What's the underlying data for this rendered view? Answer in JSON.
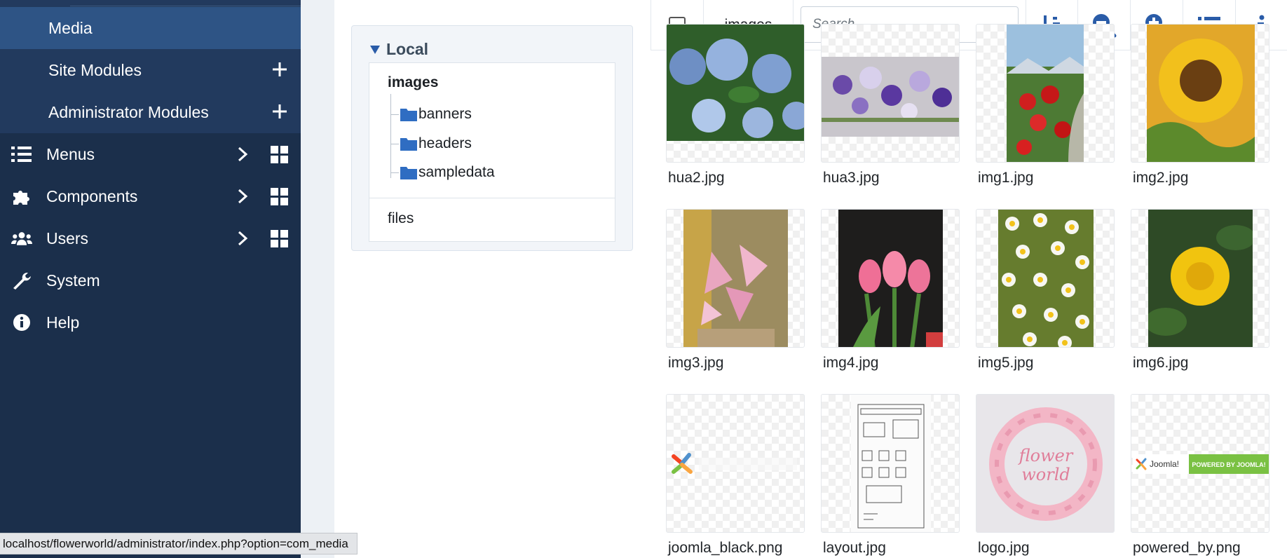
{
  "sidebar": {
    "sub_items": [
      {
        "label": "Media",
        "active": true
      },
      {
        "label": "Site Modules"
      },
      {
        "label": "Administrator Modules"
      }
    ],
    "main_items": [
      {
        "label": "Menus",
        "icon": "list-icon"
      },
      {
        "label": "Components",
        "icon": "puzzle-icon"
      },
      {
        "label": "Users",
        "icon": "users-icon"
      },
      {
        "label": "System",
        "icon": "wrench-icon"
      },
      {
        "label": "Help",
        "icon": "info-icon"
      }
    ]
  },
  "tree": {
    "disk": "Local",
    "root": "images",
    "folders": [
      "banners",
      "headers",
      "sampledata"
    ],
    "files_label": "files"
  },
  "toolbar": {
    "breadcrumb": "images",
    "search_placeholder": "Search",
    "icons": [
      "sort-icon",
      "zoom-out-icon",
      "zoom-in-icon",
      "list-view-icon",
      "info-icon"
    ]
  },
  "media": {
    "items": [
      {
        "name": "hua2.jpg"
      },
      {
        "name": "hua3.jpg"
      },
      {
        "name": "img1.jpg"
      },
      {
        "name": "img2.jpg"
      },
      {
        "name": "img3.jpg"
      },
      {
        "name": "img4.jpg"
      },
      {
        "name": "img5.jpg"
      },
      {
        "name": "img6.jpg"
      },
      {
        "name": "joomla_black.png"
      },
      {
        "name": "layout.jpg"
      },
      {
        "name": "logo.jpg",
        "logo_text": "flower world"
      },
      {
        "name": "powered_by.png",
        "banner_text": "POWERED BY JOOMLA!"
      }
    ]
  },
  "status_url": "localhost/flowerworld/administrator/index.php?option=com_media",
  "colors": {
    "sidebar": "#1b2f4b",
    "sidebar_sub": "#223a5e",
    "sidebar_active": "#2e5485",
    "icon_blue": "#2a5ca8",
    "folder_blue": "#2f6dc2"
  }
}
